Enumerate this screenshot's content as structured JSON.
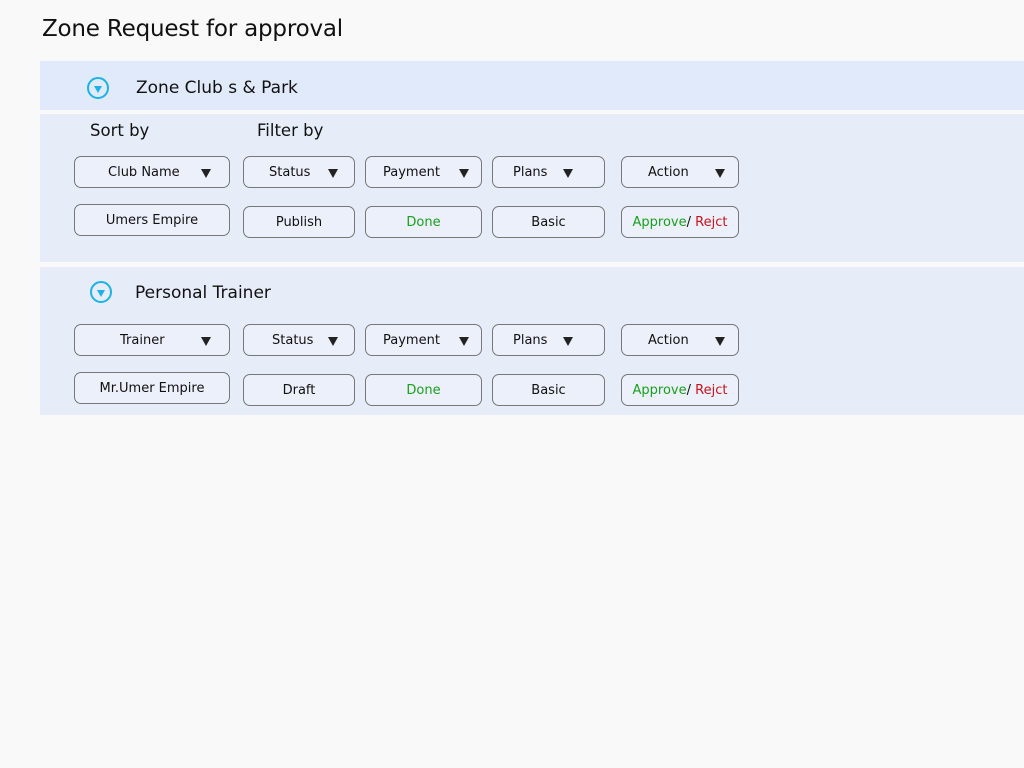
{
  "page_title": "Zone Request for approval",
  "colors": {
    "accent": "#1bb3e6",
    "approve": "#17a01e",
    "reject": "#c8141e"
  },
  "section1": {
    "title": "Zone Club s & Park",
    "sort_label": "Sort by",
    "filter_label": "Filter by",
    "dropdowns": {
      "name": "Club Name",
      "status": "Status",
      "payment": "Payment",
      "plans": "Plans",
      "action": "Action"
    },
    "row": {
      "name": "Umers Empire",
      "status": "Publish",
      "payment": "Done",
      "plan": "Basic",
      "approve": "Approve",
      "separator": "/",
      "reject": "Rejct"
    }
  },
  "section2": {
    "title": "Personal Trainer",
    "dropdowns": {
      "name": "Trainer",
      "status": "Status",
      "payment": "Payment",
      "plans": "Plans",
      "action": "Action"
    },
    "row": {
      "name": "Mr.Umer Empire",
      "status": "Draft",
      "payment": "Done",
      "plan": "Basic",
      "approve": "Approve",
      "separator": "/",
      "reject": "Rejct"
    }
  }
}
